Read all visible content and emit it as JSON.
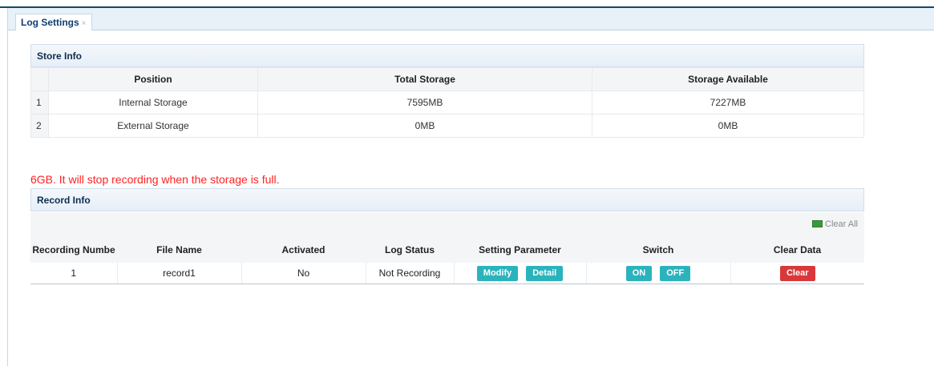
{
  "tab": {
    "label": "Log Settings",
    "close": "×"
  },
  "store_info": {
    "title": "Store Info",
    "columns": [
      "Position",
      "Total Storage",
      "Storage Available"
    ],
    "rows": [
      {
        "index": "1",
        "position": "Internal Storage",
        "total": "7595MB",
        "available": "7227MB"
      },
      {
        "index": "2",
        "position": "External Storage",
        "total": "0MB",
        "available": "0MB"
      }
    ]
  },
  "warning": "6GB. It will stop recording when the storage is full.",
  "record_info": {
    "title": "Record Info",
    "clear_all": "Clear All",
    "columns": [
      "Recording Numbe",
      "File Name",
      "Activated",
      "Log Status",
      "Setting Parameter",
      "Switch",
      "Clear Data"
    ],
    "rows": [
      {
        "number": "1",
        "file_name": "record1",
        "activated": "No",
        "status": "Not Recording",
        "modify": "Modify",
        "detail": "Detail",
        "on": "ON",
        "off": "OFF",
        "clear": "Clear"
      }
    ]
  },
  "colors": {
    "accent": "#2bb3bd",
    "danger": "#d9383a",
    "warning_text": "#ff2222",
    "tab_text": "#0d3e74"
  }
}
